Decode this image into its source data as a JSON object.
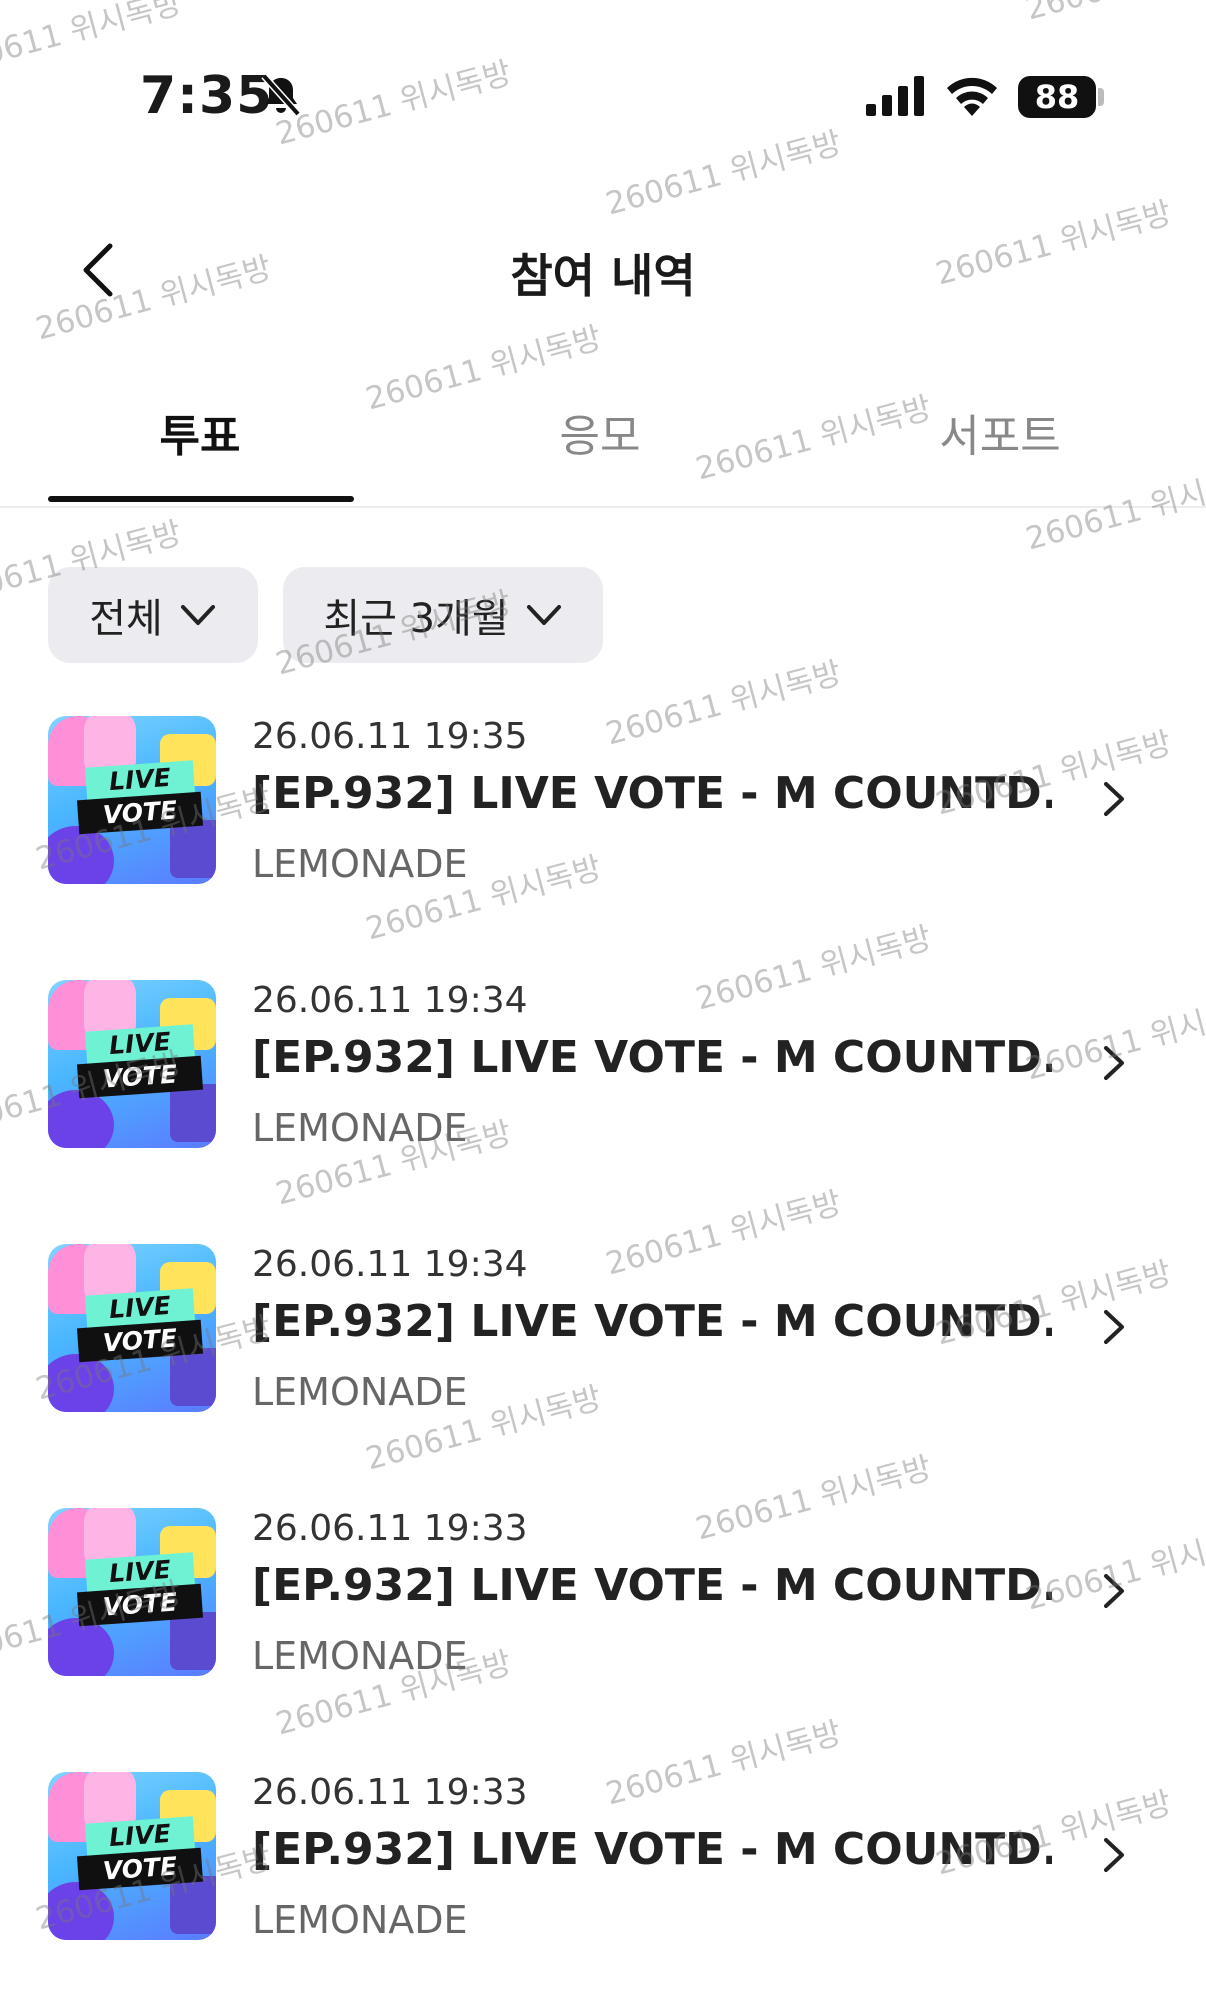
{
  "status_bar": {
    "time": "7:35",
    "battery": "88"
  },
  "header": {
    "title": "참여 내역"
  },
  "tabs": [
    {
      "label": "투표",
      "active": true
    },
    {
      "label": "응모",
      "active": false
    },
    {
      "label": "서포트",
      "active": false
    }
  ],
  "filters": {
    "type": "전체",
    "period": "최근 3개월"
  },
  "items": [
    {
      "date": "26.06.11 19:35",
      "title": "[EP.932] LIVE VOTE - M COUNTD...",
      "subtitle": "LEMONADE",
      "thumb_line1": "LIVE",
      "thumb_line2": "VOTE"
    },
    {
      "date": "26.06.11 19:34",
      "title": "[EP.932] LIVE VOTE - M COUNTD...",
      "subtitle": "LEMONADE",
      "thumb_line1": "LIVE",
      "thumb_line2": "VOTE"
    },
    {
      "date": "26.06.11 19:34",
      "title": "[EP.932] LIVE VOTE - M COUNTD...",
      "subtitle": "LEMONADE",
      "thumb_line1": "LIVE",
      "thumb_line2": "VOTE"
    },
    {
      "date": "26.06.11 19:33",
      "title": "[EP.932] LIVE VOTE - M COUNTD...",
      "subtitle": "LEMONADE",
      "thumb_line1": "LIVE",
      "thumb_line2": "VOTE"
    },
    {
      "date": "26.06.11 19:33",
      "title": "[EP.932] LIVE VOTE - M COUNTD...",
      "subtitle": "LEMONADE",
      "thumb_line1": "LIVE",
      "thumb_line2": "VOTE"
    }
  ],
  "watermark": "260611 위시독방",
  "colors": {
    "accent": "#111111",
    "filter_bg": "#ececf0",
    "muted_text": "#666666"
  }
}
